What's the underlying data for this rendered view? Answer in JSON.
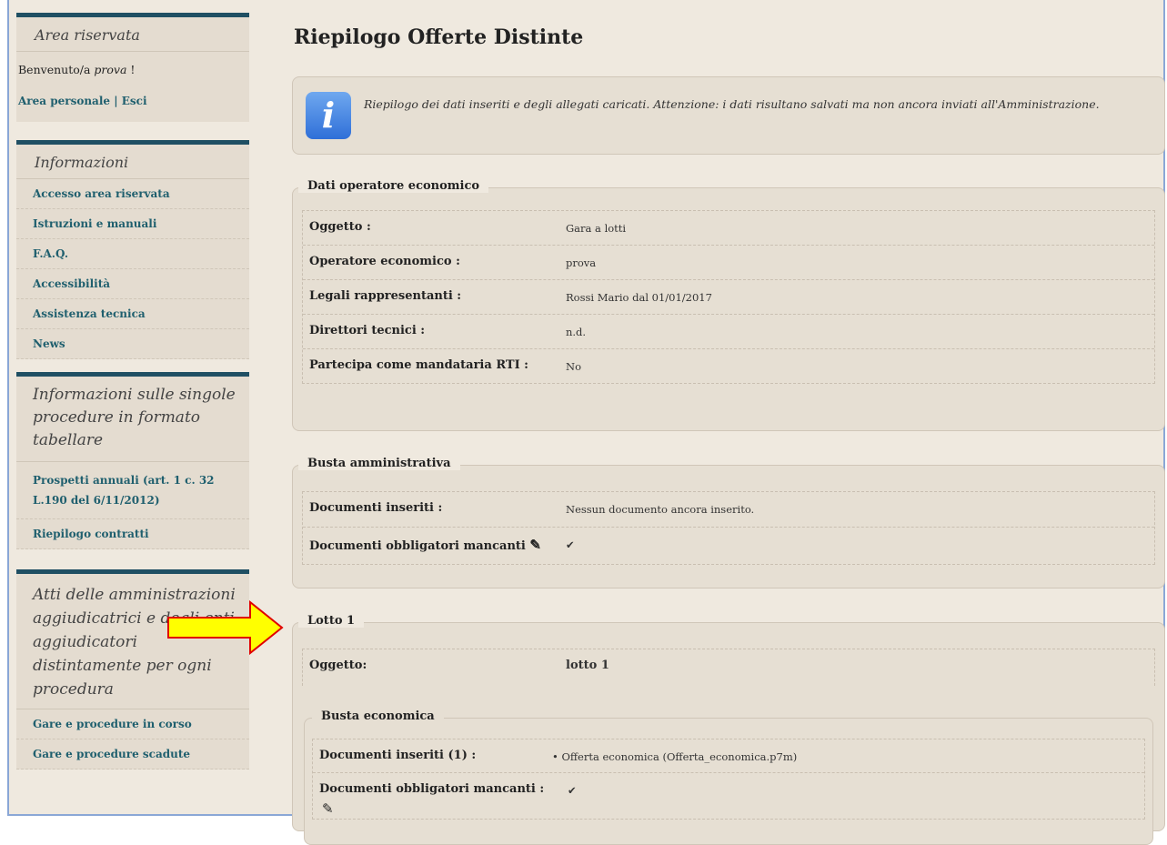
{
  "sidebar": {
    "reserved": {
      "title": "Area riservata",
      "welcome_prefix": "Benvenuto/a ",
      "welcome_user": "prova",
      "welcome_suffix": " !",
      "personal_area": "Area personale",
      "separator": " | ",
      "logout": "Esci"
    },
    "info": {
      "title": "Informazioni",
      "items": [
        "Accesso area riservata",
        "Istruzioni e manuali",
        "F.A.Q.",
        "Accessibilità",
        "Assistenza tecnica",
        "News"
      ]
    },
    "procedures": {
      "title": "Informazioni sulle singole procedure in formato tabellare",
      "items": [
        "Prospetti annuali (art. 1 c. 32 L.190 del 6/11/2012)",
        "Riepilogo contratti"
      ]
    },
    "acts": {
      "title": "Atti delle amministrazioni aggiudicatrici e degli enti aggiudicatori distintamente per ogni procedura",
      "items": [
        "Gare e procedure in corso",
        "Gare e procedure scadute"
      ]
    }
  },
  "main": {
    "title": "Riepilogo Offerte Distinte",
    "info_text": "Riepilogo dei dati inseriti e degli allegati caricati. Attenzione: i dati risultano salvati ma non ancora inviati all'Amministrazione.",
    "operator": {
      "legend": "Dati operatore economico",
      "rows": [
        {
          "label": "Oggetto :",
          "value": "Gara a lotti"
        },
        {
          "label": "Operatore economico :",
          "value": "prova"
        },
        {
          "label": "Legali rappresentanti :",
          "value": "Rossi Mario dal 01/01/2017"
        },
        {
          "label": "Direttori tecnici :",
          "value": "n.d."
        },
        {
          "label": "Partecipa come mandataria RTI :",
          "value": "No"
        }
      ]
    },
    "admin": {
      "legend": "Busta amministrativa",
      "rows": [
        {
          "label": "Documenti inseriti :",
          "value": "Nessun documento ancora inserito."
        },
        {
          "label": "Documenti obbligatori mancanti",
          "value": "✔"
        }
      ]
    },
    "lot": {
      "legend": "Lotto 1",
      "object_label": "Oggetto:",
      "object_value": "lotto 1",
      "economic": {
        "legend": "Busta economica",
        "docs_label": "Documenti inseriti (1) :",
        "docs_value": "• Offerta economica  (Offerta_economica.p7m)",
        "missing_label": "Documenti obbligatori mancanti :",
        "missing_value": "✔"
      }
    }
  }
}
